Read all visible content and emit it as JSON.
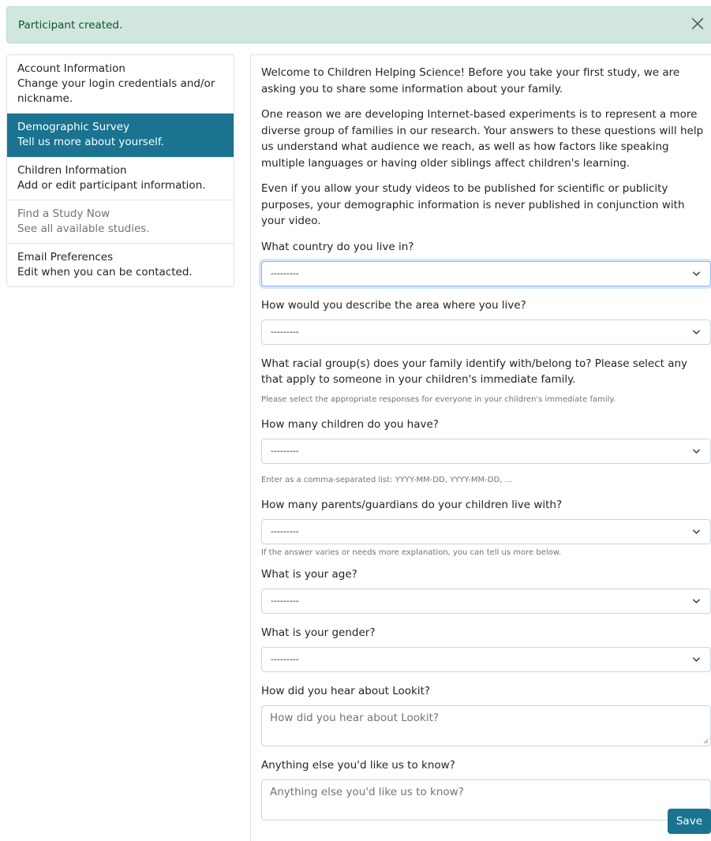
{
  "alert": {
    "message": "Participant created."
  },
  "sidebar": {
    "items": [
      {
        "title": "Account Information",
        "desc": "Change your login credentials and/or nickname."
      },
      {
        "title": "Demographic Survey",
        "desc": "Tell us more about yourself."
      },
      {
        "title": "Children Information",
        "desc": "Add or edit participant information."
      },
      {
        "title": "Find a Study Now",
        "desc": "See all available studies."
      },
      {
        "title": "Email Preferences",
        "desc": "Edit when you can be contacted."
      }
    ]
  },
  "intro": {
    "p1": "Welcome to Children Helping Science! Before you take your first study, we are asking you to share some information about your family.",
    "p2": "One reason we are developing Internet-based experiments is to represent a more diverse group of families in our research. Your answers to these questions will help us understand what audience we reach, as well as how factors like speaking multiple languages or having older siblings affect children's learning.",
    "p3": "Even if you allow your study videos to be published for scientific or publicity purposes, your demographic information is never published in conjunction with your video."
  },
  "form": {
    "country": {
      "label": "What country do you live in?",
      "value": "---------"
    },
    "area": {
      "label": "How would you describe the area where you live?",
      "value": "---------"
    },
    "race": {
      "label": "What racial group(s) does your family identify with/belong to? Please select any that apply to someone in your children's immediate family.",
      "help": "Please select the appropriate responses for everyone in your children's immediate family."
    },
    "children": {
      "label": "How many children do you have?",
      "value": "---------",
      "help": "Enter as a comma-separated list: YYYY-MM-DD, YYYY-MM-DD, ..."
    },
    "guardians": {
      "label": "How many parents/guardians do your children live with?",
      "value": "---------",
      "help": "If the answer varies or needs more explanation, you can tell us more below."
    },
    "age": {
      "label": "What is your age?",
      "value": "---------"
    },
    "gender": {
      "label": "What is your gender?",
      "value": "---------"
    },
    "lookit": {
      "label": "How did you hear about Lookit?",
      "placeholder": "How did you hear about Lookit?"
    },
    "extra": {
      "label": "Anything else you'd like us to know?",
      "placeholder": "Anything else you'd like us to know?"
    },
    "save_label": "Save"
  },
  "colors": {
    "accent": "#1a7390",
    "alert_bg": "#d1e7dd",
    "alert_text": "#0f5132"
  }
}
